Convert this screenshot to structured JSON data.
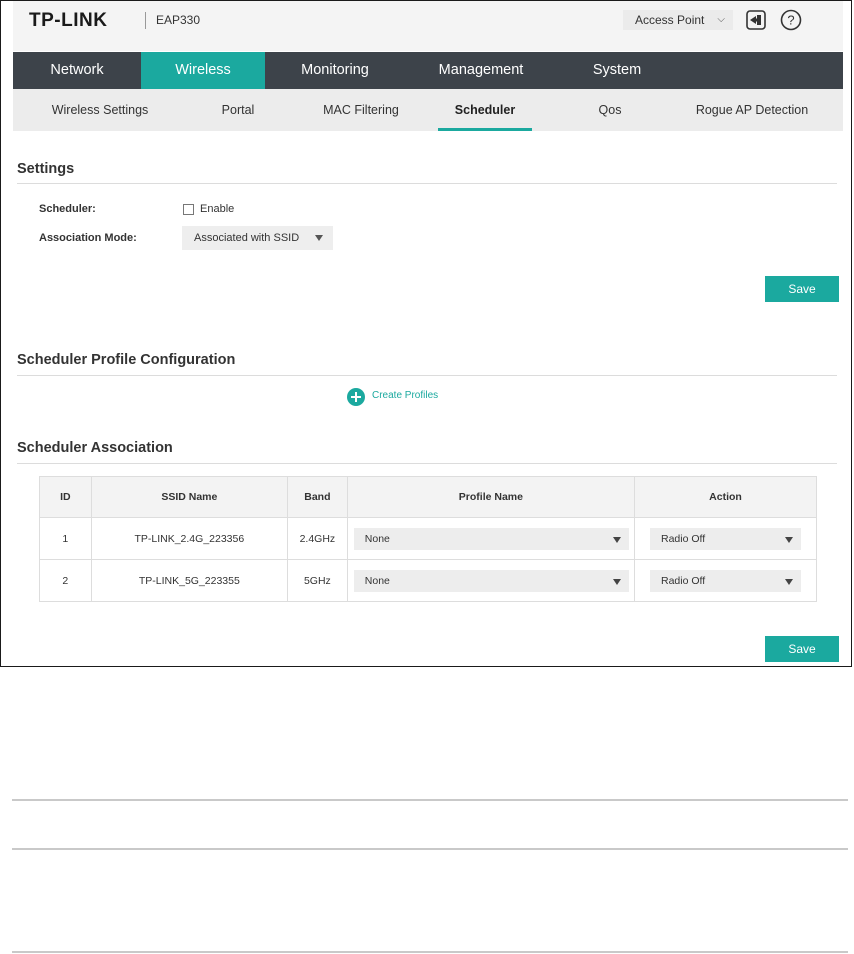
{
  "header": {
    "logo": "TP-LINK",
    "model": "EAP330",
    "mode": "Access Point"
  },
  "main_nav": [
    {
      "label": "Network"
    },
    {
      "label": "Wireless"
    },
    {
      "label": "Monitoring"
    },
    {
      "label": "Management"
    },
    {
      "label": "System"
    }
  ],
  "sub_nav": [
    {
      "label": "Wireless Settings"
    },
    {
      "label": "Portal"
    },
    {
      "label": "MAC Filtering"
    },
    {
      "label": "Scheduler"
    },
    {
      "label": "Qos"
    },
    {
      "label": "Rogue AP Detection"
    }
  ],
  "settings": {
    "title": "Settings",
    "scheduler_label": "Scheduler:",
    "enable_label": "Enable",
    "enable_checked": false,
    "association_mode_label": "Association Mode:",
    "association_mode_value": "Associated with SSID",
    "save_label": "Save"
  },
  "profile_config": {
    "title": "Scheduler Profile Configuration",
    "create_label": "Create Profiles"
  },
  "association": {
    "title": "Scheduler Association",
    "columns": [
      "ID",
      "SSID Name",
      "Band",
      "Profile Name",
      "Action"
    ],
    "rows": [
      {
        "id": "1",
        "ssid": "TP-LINK_2.4G_223356",
        "band": "2.4GHz",
        "profile": "None",
        "action": "Radio Off"
      },
      {
        "id": "2",
        "ssid": "TP-LINK_5G_223355",
        "band": "5GHz",
        "profile": "None",
        "action": "Radio Off"
      }
    ],
    "save_label": "Save"
  },
  "colors": {
    "accent": "#1ba99f",
    "nav_dark": "#3d434a"
  }
}
